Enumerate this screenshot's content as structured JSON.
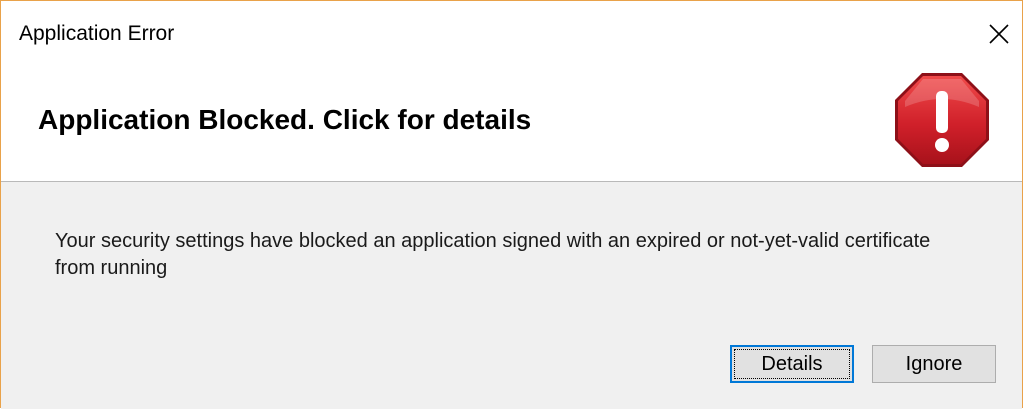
{
  "window": {
    "title": "Application Error",
    "close_icon": "close-icon"
  },
  "header": {
    "title": "Application Blocked. Click for details",
    "icon": "error-stop-icon",
    "icon_color": "#d0202a"
  },
  "body": {
    "message": "Your security settings have blocked an application signed with an expired or not-yet-valid certificate from running"
  },
  "buttons": {
    "details_label": "Details",
    "ignore_label": "Ignore"
  },
  "colors": {
    "window_border": "#e9a24a",
    "default_button_border": "#0078d7",
    "button_face": "#e1e1e1",
    "dialog_background": "#f0f0f0"
  }
}
